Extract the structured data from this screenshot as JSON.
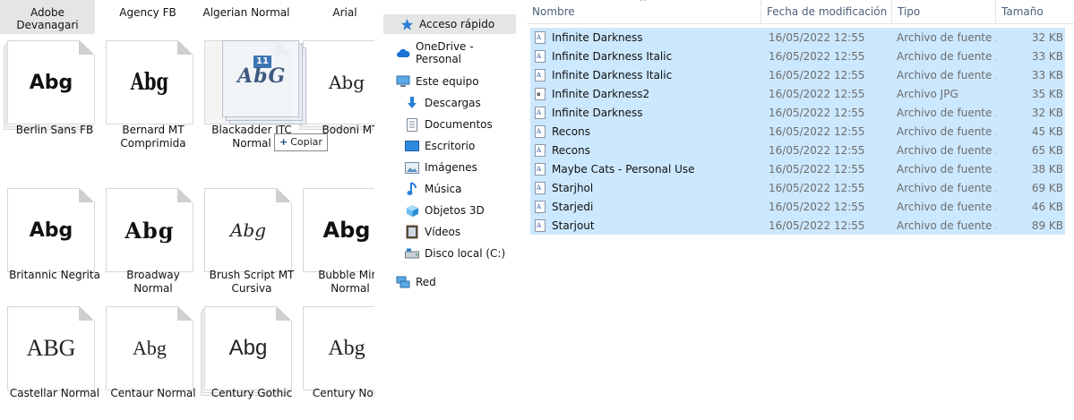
{
  "fonts_pane": {
    "top_labels": [
      "Adobe\nDevanagari",
      "Agency FB",
      "Algerian Normal",
      "Arial"
    ],
    "tiles": [
      {
        "label": "Berlin Sans FB",
        "sample": "Abg"
      },
      {
        "label": "Bernard MT\nComprimida",
        "sample": "Abg"
      },
      {
        "label": "Blackadder ITC\nNormal",
        "sample": ""
      },
      {
        "label": "Bodoni MT",
        "sample": "Abg"
      },
      {
        "label": "Britannic Negrita",
        "sample": "Abg"
      },
      {
        "label": "Broadway\nNormal",
        "sample": "Abg"
      },
      {
        "label": "Brush Script MT\nCursiva",
        "sample": "Abg"
      },
      {
        "label": "Bubble Mint\nNormal",
        "sample": "Abg"
      },
      {
        "label": "Castellar Normal",
        "sample": "ABG"
      },
      {
        "label": "Centaur Normal",
        "sample": "Abg"
      },
      {
        "label": "Century Gothic",
        "sample": "Abg"
      },
      {
        "label": "Century Norm",
        "sample": "Abg"
      }
    ],
    "drag_badge": "11",
    "drag_logo": "AbG",
    "copy_tooltip": "Copiar",
    "copy_plus": "+"
  },
  "nav": {
    "items": [
      {
        "label": "Acceso rápido",
        "icon": "star-icon"
      },
      {
        "label": "OneDrive - Personal",
        "icon": "cloud-icon"
      },
      {
        "label": "Este equipo",
        "icon": "computer-icon"
      },
      {
        "label": "Descargas",
        "icon": "download-icon"
      },
      {
        "label": "Documentos",
        "icon": "document-icon"
      },
      {
        "label": "Escritorio",
        "icon": "desktop-icon"
      },
      {
        "label": "Imágenes",
        "icon": "pictures-icon"
      },
      {
        "label": "Música",
        "icon": "music-icon"
      },
      {
        "label": "Objetos 3D",
        "icon": "cube-icon"
      },
      {
        "label": "Vídeos",
        "icon": "video-icon"
      },
      {
        "label": "Disco local (C:)",
        "icon": "drive-icon"
      },
      {
        "label": "Red",
        "icon": "network-icon"
      }
    ]
  },
  "list": {
    "columns": [
      "Nombre",
      "Fecha de modificación",
      "Tipo",
      "Tamaño"
    ],
    "sort_arrow": "^",
    "rows": [
      {
        "name": "Infinite Darkness",
        "date": "16/05/2022 12:55",
        "type": "Archivo de fuente ...",
        "size": "32 KB",
        "kind": "font"
      },
      {
        "name": "Infinite Darkness Italic",
        "date": "16/05/2022 12:55",
        "type": "Archivo de fuente ...",
        "size": "33 KB",
        "kind": "font"
      },
      {
        "name": "Infinite Darkness Italic",
        "date": "16/05/2022 12:55",
        "type": "Archivo de fuente ...",
        "size": "33 KB",
        "kind": "font"
      },
      {
        "name": "Infinite Darkness2",
        "date": "16/05/2022 12:55",
        "type": "Archivo JPG",
        "size": "35 KB",
        "kind": "jpg"
      },
      {
        "name": "Infinite Darkness",
        "date": "16/05/2022 12:55",
        "type": "Archivo de fuente ...",
        "size": "32 KB",
        "kind": "font"
      },
      {
        "name": "Recons",
        "date": "16/05/2022 12:55",
        "type": "Archivo de fuente ...",
        "size": "45 KB",
        "kind": "font"
      },
      {
        "name": "Recons",
        "date": "16/05/2022 12:55",
        "type": "Archivo de fuente ...",
        "size": "65 KB",
        "kind": "font"
      },
      {
        "name": "Maybe Cats - Personal Use",
        "date": "16/05/2022 12:55",
        "type": "Archivo de fuente ...",
        "size": "38 KB",
        "kind": "font"
      },
      {
        "name": "Starjhol",
        "date": "16/05/2022 12:55",
        "type": "Archivo de fuente ...",
        "size": "69 KB",
        "kind": "font"
      },
      {
        "name": "Starjedi",
        "date": "16/05/2022 12:55",
        "type": "Archivo de fuente ...",
        "size": "46 KB",
        "kind": "font"
      },
      {
        "name": "Starjout",
        "date": "16/05/2022 12:55",
        "type": "Archivo de fuente ...",
        "size": "89 KB",
        "kind": "font"
      }
    ],
    "selection_color": "#cce8ff"
  }
}
